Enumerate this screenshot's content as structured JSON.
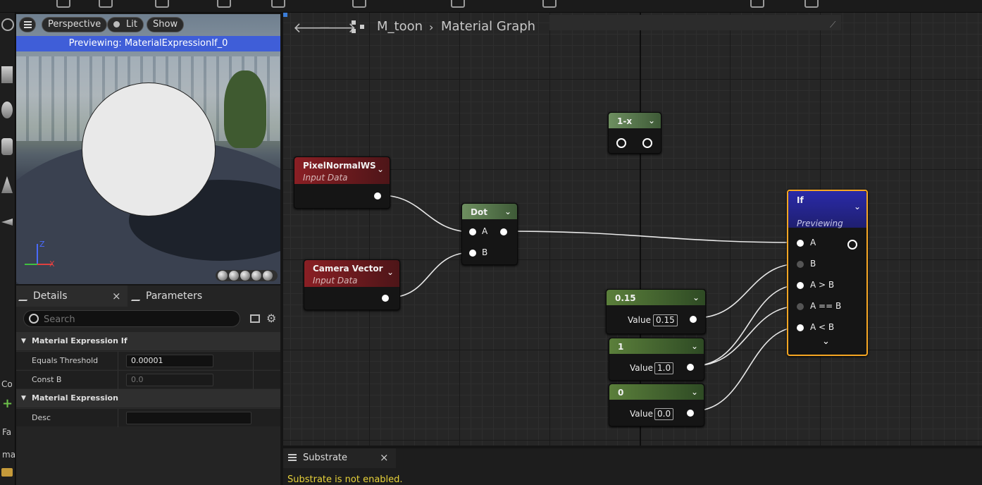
{
  "viewport": {
    "menu_icon": "hamburger-icon",
    "perspective_label": "Perspective",
    "lit_label": "Lit",
    "show_label": "Show",
    "previewing_text": "Previewing: MaterialExpressionIf_0",
    "axis_z": "Z",
    "axis_x": "X"
  },
  "details": {
    "tabs": [
      {
        "label": "Details",
        "icon": "pencil-icon"
      },
      {
        "label": "Parameters",
        "icon": "pencil-icon"
      }
    ],
    "close_glyph": "×",
    "search_placeholder": "Search",
    "categories": [
      {
        "title": "Material Expression If",
        "rows": [
          {
            "label": "Equals Threshold",
            "value": "0.00001"
          },
          {
            "label": "Const B",
            "value": "0.0"
          }
        ]
      },
      {
        "title": "Material Expression",
        "rows": [
          {
            "label": "Desc",
            "value": ""
          }
        ]
      }
    ]
  },
  "left_strip": {
    "label_co": "Co",
    "label_fa": "Fa",
    "label_ma": "ma",
    "add_glyph": "+"
  },
  "graph": {
    "asset_name": "M_toon",
    "graph_name": "Material Graph",
    "nodes": {
      "one_minus_x": {
        "title": "1-x"
      },
      "pixel_normal": {
        "title": "PixelNormalWS",
        "subtitle": "Input Data"
      },
      "camera_vector": {
        "title": "Camera Vector",
        "subtitle": "Input Data"
      },
      "dot": {
        "title": "Dot",
        "pin_a": "A",
        "pin_b": "B"
      },
      "if": {
        "title": "If",
        "subtitle": "Previewing",
        "pins": [
          "A",
          "B",
          "A > B",
          "A == B",
          "A < B"
        ]
      },
      "const_015": {
        "title": "0.15",
        "value_label": "Value",
        "value": "0.15"
      },
      "const_1": {
        "title": "1",
        "value_label": "Value",
        "value": "1.0"
      },
      "const_0": {
        "title": "0",
        "value_label": "Value",
        "value": "0.0"
      }
    }
  },
  "substrate": {
    "tab_label": "Substrate",
    "close_glyph": "×",
    "message": "Substrate is not enabled."
  },
  "colors": {
    "preview_banner": "#3f5ed8",
    "input_node_header": "#8a1f24",
    "const_node_header": "#5b7f3b",
    "func_node_header": "#4d6b45",
    "if_node_header": "#2a2aa8",
    "if_node_border": "#f5a623",
    "warning_text": "#e8d23a"
  }
}
